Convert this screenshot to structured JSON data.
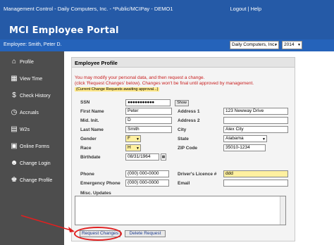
{
  "topbar": {
    "crumb": "Management Control - Daily Computers, Inc. - *Public/MCIPay - DEMO1",
    "logout": "Logout",
    "sep": " | ",
    "help": "Help"
  },
  "header": {
    "title": "MCI Employee Portal"
  },
  "employee_bar": {
    "employee": "Employee: Smith, Peter D.",
    "company": "Daily Computers, Inc.",
    "year": "2014"
  },
  "sidebar": {
    "items": [
      {
        "label": "Profile",
        "icon": "home-icon"
      },
      {
        "label": "View Time",
        "icon": "calendar-icon"
      },
      {
        "label": "Check History",
        "icon": "money-bag-icon"
      },
      {
        "label": "Accruals",
        "icon": "clock-icon"
      },
      {
        "label": "W2s",
        "icon": "document-icon"
      },
      {
        "label": "Online Forms",
        "icon": "forms-icon"
      },
      {
        "label": "Change Login",
        "icon": "user-icon"
      },
      {
        "label": "Change Profile",
        "icon": "user-settings-icon"
      }
    ]
  },
  "profile": {
    "heading": "Employee Profile",
    "notice1": "You may modify your personal data, and then request a change.",
    "notice2": "(click 'Request Changes' below). Changes won't be final until approved by management.",
    "notice3": "(Current Change Requests awaiting approval...)",
    "labels": {
      "ssn": "SSN",
      "first_name": "First Name",
      "mid_init": "Mid. Init.",
      "last_name": "Last Name",
      "gender": "Gender",
      "race": "Race",
      "birthdate": "Birthdate",
      "address1": "Address 1",
      "address2": "Address 2",
      "city": "City",
      "state": "State",
      "zip": "ZIP Code",
      "phone": "Phone",
      "emergency_phone": "Emergency Phone",
      "license": "Driver's Licence #",
      "email": "Email",
      "misc": "Misc. Updates"
    },
    "values": {
      "ssn": "●●●●●●●●●●●",
      "first_name": "Peter",
      "mid_init": "D",
      "last_name": "Smith",
      "gender": "F",
      "race": "H",
      "birthdate": "08/31/1964",
      "address1": "123 Newway Drive",
      "address2": "",
      "city": "Alex City",
      "state": "Alabama",
      "zip": "35010-1234",
      "phone": "(000) 000-0000",
      "emergency_phone": "(000) 000-0000",
      "license": "ddd",
      "email": ""
    },
    "show_button": "Show",
    "request_button": "Request Changes",
    "delete_button": "Delete Request"
  },
  "colors": {
    "topbar": "#255aa7",
    "sidebar": "#4d4d4d",
    "notice": "#c81e1e",
    "highlight": "#e02020"
  }
}
